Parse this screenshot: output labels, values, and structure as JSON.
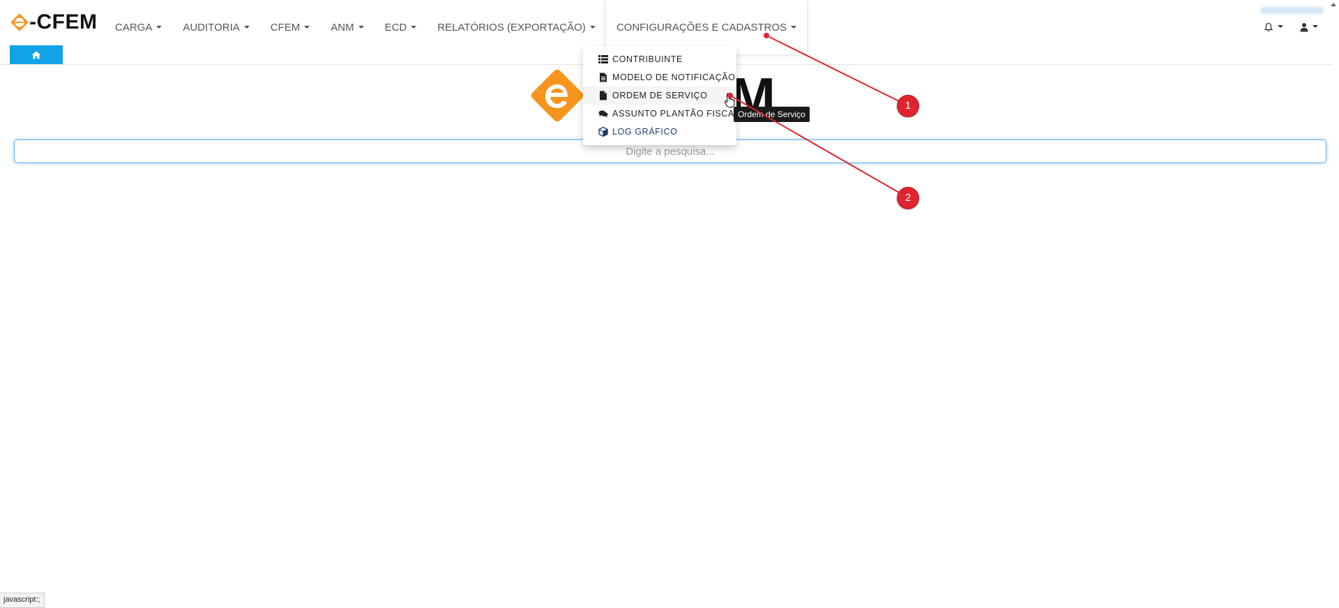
{
  "brand": {
    "text": "-CFEM"
  },
  "nav": {
    "items": [
      {
        "label": "CARGA"
      },
      {
        "label": "AUDITORIA"
      },
      {
        "label": "CFEM"
      },
      {
        "label": "ANM"
      },
      {
        "label": "ECD"
      },
      {
        "label": "RELATÓRIOS (EXPORTAÇÃO)"
      },
      {
        "label": "CONFIGURAÇÕES E CADASTROS"
      }
    ]
  },
  "header_right": {
    "bell_icon": "bell-icon",
    "user_icon": "user-icon"
  },
  "home_tab": {
    "icon": "home-icon"
  },
  "center_logo": {
    "text": "M"
  },
  "search": {
    "placeholder": "Digite a pesquisa..."
  },
  "dropdown": {
    "items": [
      {
        "label": "CONTRIBUINTE",
        "icon": "list-icon"
      },
      {
        "label": "MODELO DE NOTIFICAÇÃO",
        "icon": "file-text-icon"
      },
      {
        "label": "ORDEM DE SERVIÇO",
        "icon": "file-icon"
      },
      {
        "label": "ASSUNTO PLANTÃO FISCAL",
        "icon": "comments-icon"
      },
      {
        "label": "LOG GRÁFICO",
        "icon": "cube-icon"
      }
    ]
  },
  "tooltip": {
    "text": "Ordem de Serviço"
  },
  "annotations": {
    "marker1": "1",
    "marker2": "2"
  },
  "statusbar": {
    "text": "javascript:;"
  },
  "colors": {
    "accent": "#12a3e6",
    "brand_orange": "#f7941d",
    "marker_red": "#e0242f"
  }
}
